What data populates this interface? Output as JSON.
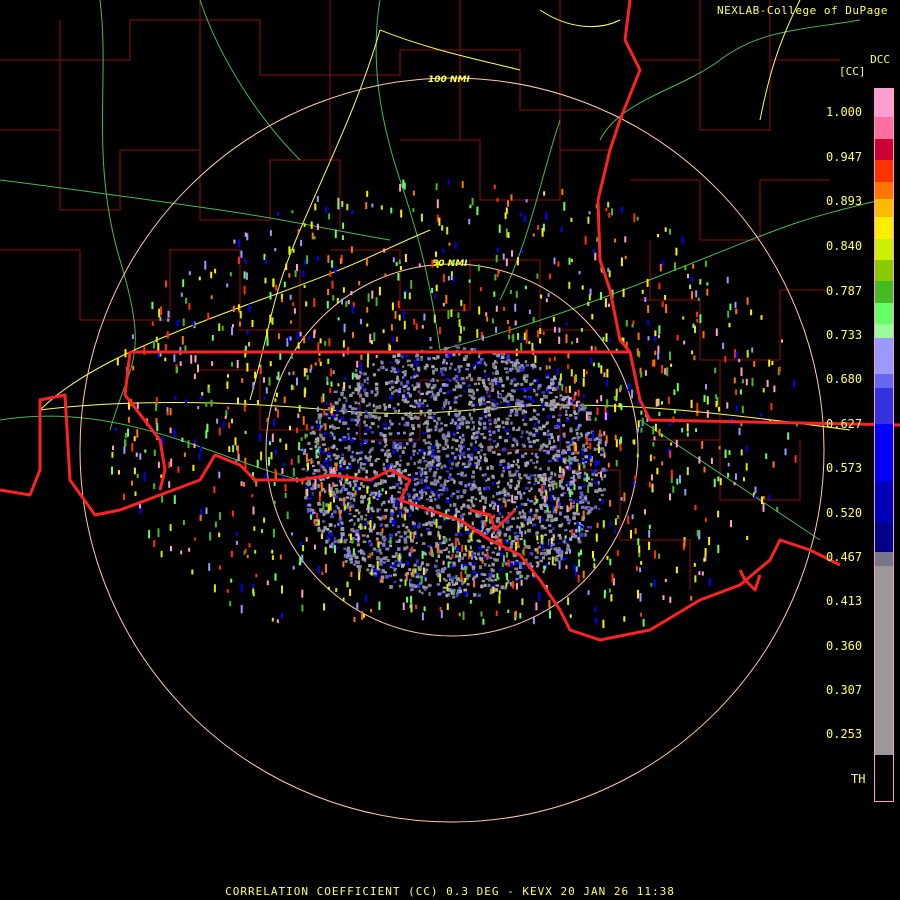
{
  "credit": "NEXLAB-College of DuPage",
  "dcc_label": "DCC",
  "legend": {
    "unit": "[CC]",
    "labels": [
      "1.000",
      "0.947",
      "0.893",
      "0.840",
      "0.787",
      "0.733",
      "0.680",
      "0.627",
      "0.573",
      "0.520",
      "0.467",
      "0.413",
      "0.360",
      "0.307",
      "0.253",
      "TH"
    ]
  },
  "range_rings": [
    {
      "label": "50 NMI",
      "range_nmi": 50
    },
    {
      "label": "100 NMI",
      "range_nmi": 100
    }
  ],
  "footer": "CORRELATION COEFFICIENT (CC) 0.3 DEG - KEVX 20 JAN 26 11:38",
  "colors": {
    "text": "#ffff66",
    "state_border": "#ff2222",
    "county_border": "#cc1111",
    "highway": "#ffff55",
    "road": "#66dd66",
    "ring": "#ffccaa"
  },
  "colorbar": [
    {
      "color": "#ff9fcf",
      "frac": 0.04
    },
    {
      "color": "#ff6fa0",
      "frac": 0.03
    },
    {
      "color": "#cc0033",
      "frac": 0.03
    },
    {
      "color": "#ff3300",
      "frac": 0.03
    },
    {
      "color": "#ff7700",
      "frac": 0.025
    },
    {
      "color": "#ffbb00",
      "frac": 0.025
    },
    {
      "color": "#ffee00",
      "frac": 0.03
    },
    {
      "color": "#ccee00",
      "frac": 0.03
    },
    {
      "color": "#88cc00",
      "frac": 0.03
    },
    {
      "color": "#44bb22",
      "frac": 0.03
    },
    {
      "color": "#66ff66",
      "frac": 0.03
    },
    {
      "color": "#99ff99",
      "frac": 0.02
    },
    {
      "color": "#9999ff",
      "frac": 0.05
    },
    {
      "color": "#6666ee",
      "frac": 0.02
    },
    {
      "color": "#3333dd",
      "frac": 0.05
    },
    {
      "color": "#0000ff",
      "frac": 0.08
    },
    {
      "color": "#0000bb",
      "frac": 0.06
    },
    {
      "color": "#000088",
      "frac": 0.04
    },
    {
      "color": "#777788",
      "frac": 0.02
    },
    {
      "color": "#999999",
      "frac": 0.265
    },
    {
      "color": "#000000",
      "frac": 0.01
    }
  ]
}
